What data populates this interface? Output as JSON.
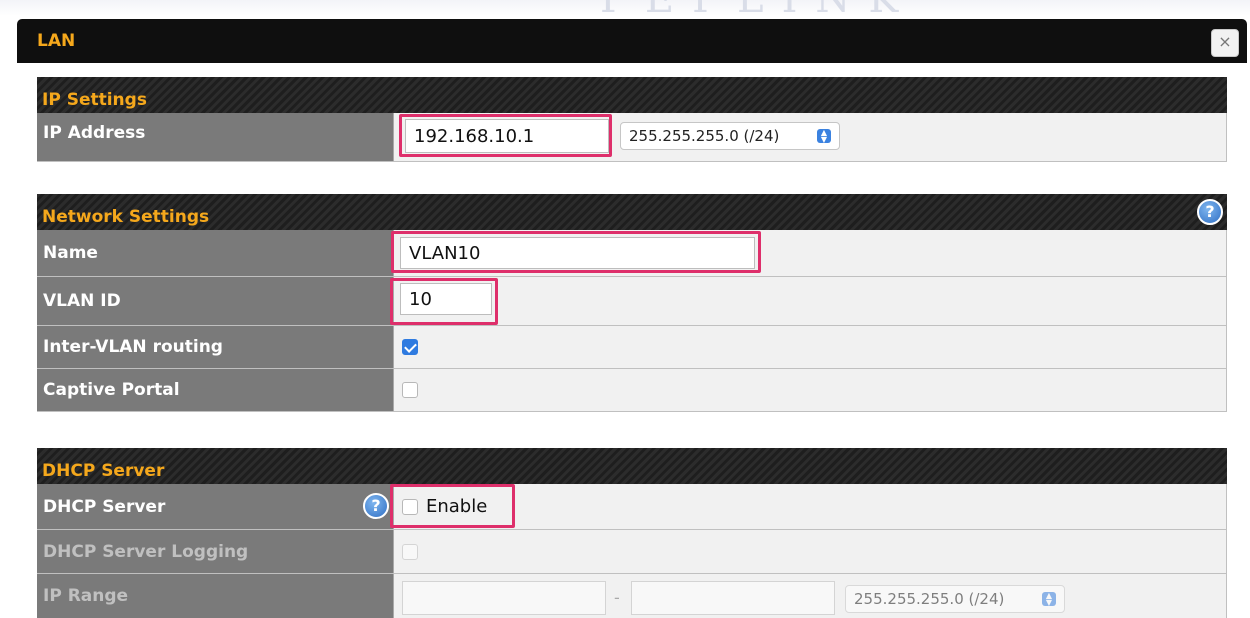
{
  "dialog": {
    "title": "LAN",
    "close_label": "×"
  },
  "ip_settings": {
    "title": "IP Settings",
    "ip_address_label": "IP Address",
    "ip_address_value": "192.168.10.1",
    "subnet_mask": "255.255.255.0 (/24)"
  },
  "network_settings": {
    "title": "Network Settings",
    "help_icon": "?",
    "name_label": "Name",
    "name_value": "VLAN10",
    "vlan_id_label": "VLAN ID",
    "vlan_id_value": "10",
    "inter_vlan_label": "Inter-VLAN routing",
    "inter_vlan_checked": true,
    "captive_portal_label": "Captive Portal",
    "captive_portal_checked": false
  },
  "dhcp_server": {
    "title": "DHCP Server",
    "help_icon": "?",
    "server_label": "DHCP Server",
    "enable_label": "Enable",
    "enable_checked": false,
    "logging_label": "DHCP Server Logging",
    "logging_checked": false,
    "ip_range_label": "IP Range",
    "ip_range_separator": "-",
    "ip_range_start": "",
    "ip_range_end": "",
    "ip_range_mask": "255.255.255.0 (/24)"
  },
  "colors": {
    "accent_orange": "#f5a81c",
    "highlight_pink": "#de2f6b",
    "checkbox_blue": "#2f7be0"
  }
}
